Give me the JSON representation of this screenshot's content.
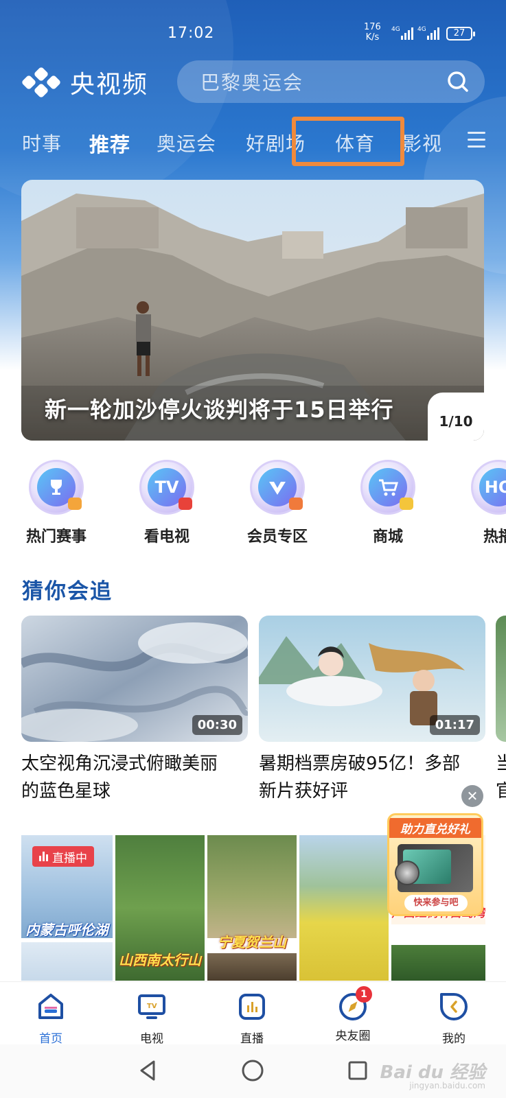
{
  "status_bar": {
    "time": "17:02",
    "net_speed_value": "176",
    "net_speed_unit": "K/s",
    "signal_label_1": "4G",
    "signal_label_2": "4G",
    "battery": "27"
  },
  "header": {
    "app_name": "央视频",
    "search_placeholder": "巴黎奥运会"
  },
  "tabs": [
    {
      "label": "时事",
      "active": false
    },
    {
      "label": "推荐",
      "active": true
    },
    {
      "label": "奥运会",
      "active": false
    },
    {
      "label": "好剧场",
      "active": false
    },
    {
      "label": "体育",
      "active": false,
      "highlighted": true
    },
    {
      "label": "影视",
      "active": false
    }
  ],
  "banner": {
    "title": "新一轮加沙停火谈判将于15日举行",
    "counter": "1/10"
  },
  "quick_entries": [
    {
      "label": "热门赛事",
      "icon": "trophy-icon"
    },
    {
      "label": "看电视",
      "icon": "tv-icon",
      "glyph": "TV"
    },
    {
      "label": "会员专区",
      "icon": "vip-icon"
    },
    {
      "label": "商城",
      "icon": "cart-icon"
    },
    {
      "label": "热播",
      "icon": "hot-icon",
      "glyph": "HO"
    }
  ],
  "section": {
    "title": "猜你会追"
  },
  "cards": [
    {
      "title_line1": "太空视角沉浸式俯瞰美丽",
      "title_line2": "的蓝色星球",
      "duration": "00:30"
    },
    {
      "title_line1": "暑期档票房破95亿！多部",
      "title_line2": "新片获好评",
      "duration": "01:17"
    }
  ],
  "edge_card": {
    "title_line1": "当",
    "title_line2": "官"
  },
  "live_grid": {
    "badge": "直播中",
    "captions": [
      "内蒙古呼伦湖",
      "山西南太行山",
      "宁夏贺兰山",
      "广西红树林白鹭湾"
    ]
  },
  "promo": {
    "title": "助力直兑好礼",
    "button": "快来参与吧"
  },
  "bottom_nav": [
    {
      "label": "首页",
      "active": true,
      "icon": "home-icon"
    },
    {
      "label": "电视",
      "active": false,
      "icon": "tv-nav-icon"
    },
    {
      "label": "直播",
      "active": false,
      "icon": "live-nav-icon"
    },
    {
      "label": "央友圈",
      "active": false,
      "icon": "compass-icon",
      "badge": "1"
    },
    {
      "label": "我的",
      "active": false,
      "icon": "profile-icon"
    }
  ],
  "watermark": {
    "brand": "Bai du 经验",
    "url": "jingyan.baidu.com"
  },
  "colors": {
    "header_blue": "#1f5fb8",
    "highlight_orange": "#f08a3c",
    "section_title_blue": "#1a55a7",
    "active_nav_blue": "#2a6fd6",
    "badge_red": "#e8323a"
  }
}
